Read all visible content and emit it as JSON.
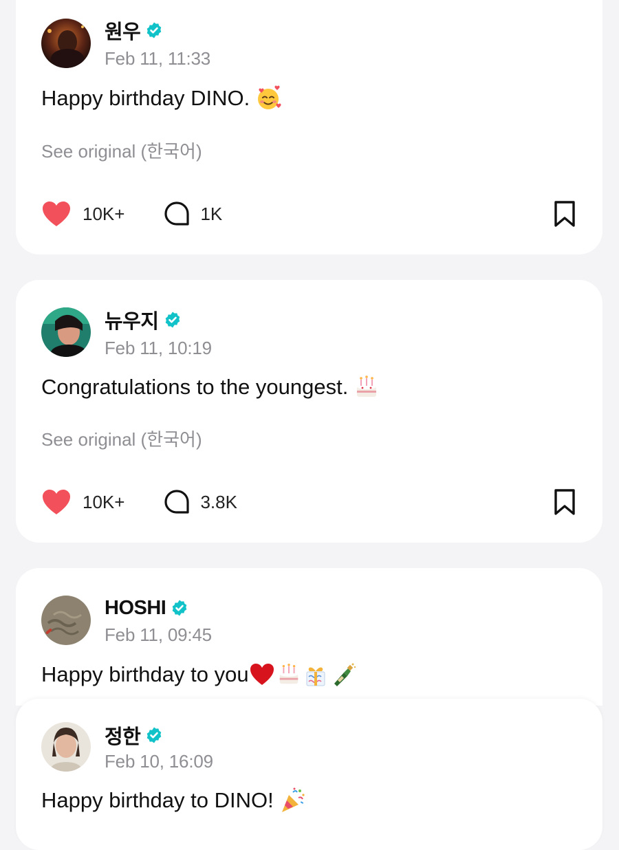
{
  "posts": [
    {
      "author": "원우",
      "verified": true,
      "date": "Feb 11, 11:33",
      "text": "Happy birthday DINO.",
      "emojis": [
        "smiling-face-with-hearts"
      ],
      "see_original": "See original (한국어)",
      "likes": "10K+",
      "comments": "1K"
    },
    {
      "author": "뉴우지",
      "verified": true,
      "date": "Feb 11, 10:19",
      "text": "Congratulations to the youngest.",
      "emojis": [
        "birthday-cake"
      ],
      "see_original": "See original (한국어)",
      "likes": "10K+",
      "comments": "3.8K"
    },
    {
      "author": "HOSHI",
      "verified": true,
      "date": "Feb 11, 09:45",
      "text": "Happy birthday to you",
      "emojis": [
        "red-heart",
        "birthday-cake",
        "wrapped-gift",
        "champagne-bottle"
      ]
    },
    {
      "author": "정한",
      "verified": true,
      "date": "Feb 10, 16:09",
      "text": "Happy birthday to DINO!",
      "emojis": [
        "party-popper"
      ]
    }
  ],
  "colors": {
    "background": "#f4f4f6",
    "card": "#ffffff",
    "verified_badge": "#12c2c9",
    "like_heart": "#f2515b",
    "secondary_text": "#8e8e93"
  }
}
